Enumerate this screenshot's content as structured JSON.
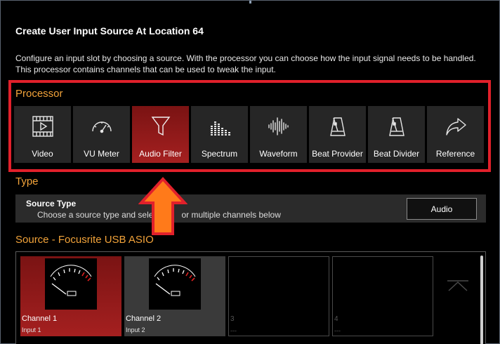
{
  "dialog": {
    "title": "Create User Input Source At Location 64",
    "description": "Configure an input slot by choosing a source. With the processor you can choose how the input signal needs to be handled. This processor contains channels that can be used to tweak the input."
  },
  "processor": {
    "heading": "Processor",
    "items": [
      {
        "label": "Video",
        "icon": "video-icon",
        "active": false
      },
      {
        "label": "VU Meter",
        "icon": "gauge-icon",
        "active": false
      },
      {
        "label": "Audio Filter",
        "icon": "funnel-icon",
        "active": true
      },
      {
        "label": "Spectrum",
        "icon": "spectrum-icon",
        "active": false
      },
      {
        "label": "Waveform",
        "icon": "waveform-icon",
        "active": false
      },
      {
        "label": "Beat Provider",
        "icon": "metronome-icon",
        "active": false
      },
      {
        "label": "Beat Divider",
        "icon": "metronome-icon",
        "active": false
      },
      {
        "label": "Reference",
        "icon": "share-arrow-icon",
        "active": false
      }
    ]
  },
  "type": {
    "heading": "Type",
    "source_type_title": "Source Type",
    "source_type_desc": "Choose a source type and sele",
    "source_type_desc_tail": "or multiple channels below",
    "source_type_value": "Audio"
  },
  "source": {
    "heading": "Source - Focusrite USB ASIO",
    "channels": [
      {
        "name": "Channel 1",
        "input": "Input 1"
      },
      {
        "name": "Channel 2",
        "input": "Input 2"
      },
      {
        "number": "3",
        "input": "---"
      },
      {
        "number": "4",
        "input": "---"
      }
    ]
  },
  "colors": {
    "accent_orange": "#f2a33a",
    "highlight_red": "#e1202b",
    "active_red": "#a52020",
    "arrow_orange": "#ff7a1a"
  }
}
